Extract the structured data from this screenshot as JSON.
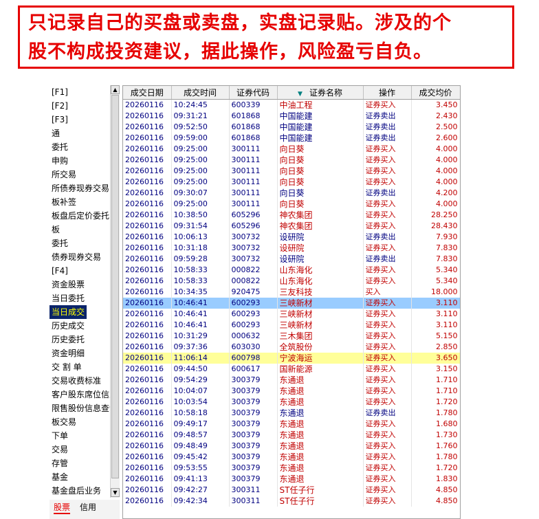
{
  "banner": {
    "line1": "只记录自己的买盘或卖盘，实盘记录贴。涉及的个",
    "line2": "股不构成投资建议，据此操作，风险盈亏自负。"
  },
  "sidebar": {
    "items": [
      "[F1]",
      "[F2]",
      "[F3]",
      "通",
      "委托",
      "申购",
      "所交易",
      "所债券现券交易",
      "板补签",
      "板盘后定价委托",
      "板",
      "委托",
      "债券现券交易",
      "[F4]",
      "资金股票",
      "当日委托",
      "当日成交",
      "历史成交",
      "历史委托",
      "资金明细",
      "交 割 单",
      "交易收费标准",
      "客户股东席位信息",
      "限售股份信息查询",
      "板交易",
      "下单",
      "交易",
      "存管",
      "基金",
      "基金盘后业务"
    ],
    "active_index": 16,
    "bottom_tabs": [
      "股票",
      "信用"
    ]
  },
  "table": {
    "headers": [
      "成交日期",
      "成交时间",
      "证券代码",
      "证券名称",
      "操作",
      "成交均价"
    ],
    "rows": [
      {
        "date": "20260116",
        "time": "10:24:45",
        "code": "600339",
        "name": "中油工程",
        "op": "证券买入",
        "price": "3.450"
      },
      {
        "date": "20260116",
        "time": "09:31:21",
        "code": "601868",
        "name": "中国能建",
        "op": "证券卖出",
        "price": "2.430"
      },
      {
        "date": "20260116",
        "time": "09:52:50",
        "code": "601868",
        "name": "中国能建",
        "op": "证券卖出",
        "price": "2.500"
      },
      {
        "date": "20260116",
        "time": "09:59:00",
        "code": "601868",
        "name": "中国能建",
        "op": "证券卖出",
        "price": "2.600"
      },
      {
        "date": "20260116",
        "time": "09:25:00",
        "code": "300111",
        "name": "向日葵",
        "op": "证券买入",
        "price": "4.000"
      },
      {
        "date": "20260116",
        "time": "09:25:00",
        "code": "300111",
        "name": "向日葵",
        "op": "证券买入",
        "price": "4.000"
      },
      {
        "date": "20260116",
        "time": "09:25:00",
        "code": "300111",
        "name": "向日葵",
        "op": "证券买入",
        "price": "4.000"
      },
      {
        "date": "20260116",
        "time": "09:25:00",
        "code": "300111",
        "name": "向日葵",
        "op": "证券买入",
        "price": "4.000"
      },
      {
        "date": "20260116",
        "time": "09:30:07",
        "code": "300111",
        "name": "向日葵",
        "op": "证券卖出",
        "price": "4.200"
      },
      {
        "date": "20260116",
        "time": "09:25:00",
        "code": "300111",
        "name": "向日葵",
        "op": "证券买入",
        "price": "4.000"
      },
      {
        "date": "20260116",
        "time": "10:38:50",
        "code": "605296",
        "name": "神农集团",
        "op": "证券买入",
        "price": "28.250"
      },
      {
        "date": "20260116",
        "time": "09:31:54",
        "code": "605296",
        "name": "神农集团",
        "op": "证券买入",
        "price": "28.430"
      },
      {
        "date": "20260116",
        "time": "10:06:13",
        "code": "300732",
        "name": "设研院",
        "op": "证券卖出",
        "price": "7.930"
      },
      {
        "date": "20260116",
        "time": "10:31:18",
        "code": "300732",
        "name": "设研院",
        "op": "证券买入",
        "price": "7.830"
      },
      {
        "date": "20260116",
        "time": "09:59:28",
        "code": "300732",
        "name": "设研院",
        "op": "证券卖出",
        "price": "7.830"
      },
      {
        "date": "20260116",
        "time": "10:58:33",
        "code": "000822",
        "name": "山东海化",
        "op": "证券买入",
        "price": "5.340"
      },
      {
        "date": "20260116",
        "time": "10:58:33",
        "code": "000822",
        "name": "山东海化",
        "op": "证券买入",
        "price": "5.340"
      },
      {
        "date": "20260116",
        "time": "10:34:35",
        "code": "920475",
        "name": "三友科技",
        "op": "买入",
        "price": "18.000"
      },
      {
        "date": "20260116",
        "time": "10:46:41",
        "code": "600293",
        "name": "三峡新材",
        "op": "证券买入",
        "price": "3.110"
      },
      {
        "date": "20260116",
        "time": "10:46:41",
        "code": "600293",
        "name": "三峡新材",
        "op": "证券买入",
        "price": "3.110"
      },
      {
        "date": "20260116",
        "time": "10:46:41",
        "code": "600293",
        "name": "三峡新材",
        "op": "证券买入",
        "price": "3.110"
      },
      {
        "date": "20260116",
        "time": "10:31:29",
        "code": "000632",
        "name": "三木集团",
        "op": "证券买入",
        "price": "5.150"
      },
      {
        "date": "20260116",
        "time": "09:37:36",
        "code": "603030",
        "name": "全筑股份",
        "op": "证券买入",
        "price": "2.850"
      },
      {
        "date": "20260116",
        "time": "11:06:14",
        "code": "600798",
        "name": "宁波海运",
        "op": "证券买入",
        "price": "3.650"
      },
      {
        "date": "20260116",
        "time": "09:44:50",
        "code": "600617",
        "name": "国新能源",
        "op": "证券买入",
        "price": "3.150"
      },
      {
        "date": "20260116",
        "time": "09:54:29",
        "code": "300379",
        "name": "东通退",
        "op": "证券买入",
        "price": "1.710"
      },
      {
        "date": "20260116",
        "time": "10:04:07",
        "code": "300379",
        "name": "东通退",
        "op": "证券买入",
        "price": "1.710"
      },
      {
        "date": "20260116",
        "time": "10:03:54",
        "code": "300379",
        "name": "东通退",
        "op": "证券买入",
        "price": "1.720"
      },
      {
        "date": "20260116",
        "time": "10:58:18",
        "code": "300379",
        "name": "东通退",
        "op": "证券卖出",
        "price": "1.780"
      },
      {
        "date": "20260116",
        "time": "09:49:17",
        "code": "300379",
        "name": "东通退",
        "op": "证券买入",
        "price": "1.680"
      },
      {
        "date": "20260116",
        "time": "09:48:57",
        "code": "300379",
        "name": "东通退",
        "op": "证券买入",
        "price": "1.730"
      },
      {
        "date": "20260116",
        "time": "09:48:49",
        "code": "300379",
        "name": "东通退",
        "op": "证券买入",
        "price": "1.760"
      },
      {
        "date": "20260116",
        "time": "09:45:42",
        "code": "300379",
        "name": "东通退",
        "op": "证券买入",
        "price": "1.780"
      },
      {
        "date": "20260116",
        "time": "09:53:55",
        "code": "300379",
        "name": "东通退",
        "op": "证券买入",
        "price": "1.720"
      },
      {
        "date": "20260116",
        "time": "09:41:13",
        "code": "300379",
        "name": "东通退",
        "op": "证券买入",
        "price": "1.830"
      },
      {
        "date": "20260116",
        "time": "09:42:27",
        "code": "300311",
        "name": "ST任子行",
        "op": "证券买入",
        "price": "4.850"
      },
      {
        "date": "20260116",
        "time": "09:42:34",
        "code": "300311",
        "name": "ST任子行",
        "op": "证券买入",
        "price": "4.850"
      }
    ],
    "selected_index": 18,
    "highlight_index": 23,
    "colors": {
      "buy": "#c00000",
      "sell": "#000080",
      "selected": "#99ccff",
      "highlight": "#ffff99"
    }
  }
}
